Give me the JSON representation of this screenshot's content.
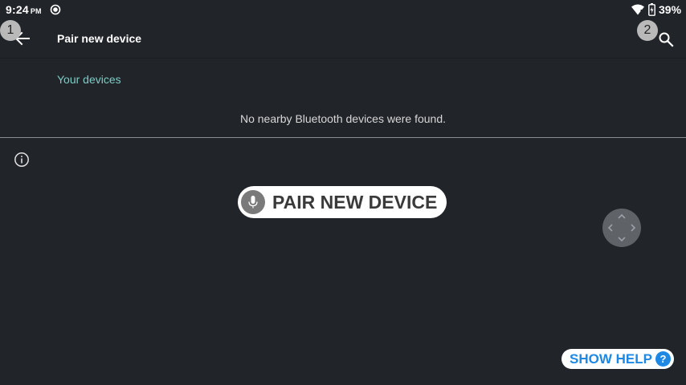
{
  "status_bar": {
    "time": "9:24",
    "ampm": "PM",
    "battery_percent": "39%",
    "icons": [
      "sync-icon",
      "wifi-icon",
      "battery-charging-icon"
    ]
  },
  "app_bar": {
    "title": "Pair new device",
    "back_icon": "arrow-back-icon",
    "search_icon": "search-icon"
  },
  "overlay_badges": {
    "back": "1",
    "search": "2"
  },
  "devices_section": {
    "header": "Your devices",
    "empty_message": "No nearby Bluetooth devices were found."
  },
  "info_icon": "info-icon",
  "voice_command": {
    "label": "PAIR NEW DEVICE",
    "icon": "mic-icon"
  },
  "navigation": {
    "icon": "dpad-icon"
  },
  "help": {
    "label": "SHOW HELP",
    "badge": "?"
  },
  "colors": {
    "background": "#212429",
    "accent": "#80cbc4",
    "help_blue": "#1e88e5",
    "divider": "#8a8d91"
  }
}
